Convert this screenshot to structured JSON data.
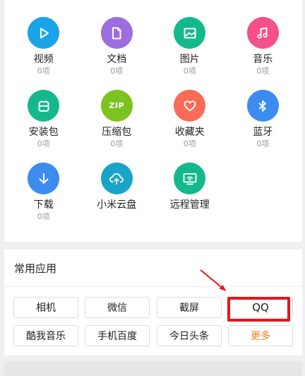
{
  "categories": [
    {
      "label": "视频",
      "count": "0项",
      "icon": "play-icon",
      "color": "#1aa3e8"
    },
    {
      "label": "文档",
      "count": "0项",
      "icon": "document-icon",
      "color": "#9b6ee0"
    },
    {
      "label": "图片",
      "count": "0项",
      "icon": "image-icon",
      "color": "#14b98b"
    },
    {
      "label": "音乐",
      "count": "0项",
      "icon": "music-icon",
      "color": "#f5508a"
    },
    {
      "label": "安装包",
      "count": "0项",
      "icon": "package-icon",
      "color": "#14b98b"
    },
    {
      "label": "压缩包",
      "count": "0项",
      "icon": "zip-icon",
      "color": "#7cc31f",
      "glyph": "ZIP"
    },
    {
      "label": "收藏夹",
      "count": "0项",
      "icon": "heart-icon",
      "color": "#fb6b55"
    },
    {
      "label": "蓝牙",
      "count": "0项",
      "icon": "bluetooth-icon",
      "color": "#3c8cf0"
    },
    {
      "label": "下载",
      "count": "0项",
      "icon": "download-icon",
      "color": "#3c8cf0"
    },
    {
      "label": "小米云盘",
      "icon": "cloud-icon",
      "color": "#1aa3c8"
    },
    {
      "label": "远程管理",
      "icon": "remote-icon",
      "color": "#14b98b"
    }
  ],
  "common_apps": {
    "title": "常用应用",
    "buttons": [
      "相机",
      "微信",
      "截屏",
      "QQ",
      "酷我音乐",
      "手机百度",
      "今日头条",
      "更多"
    ]
  },
  "colors": {
    "accent_more": "#ff7a1a",
    "highlight": "#e8141a"
  }
}
